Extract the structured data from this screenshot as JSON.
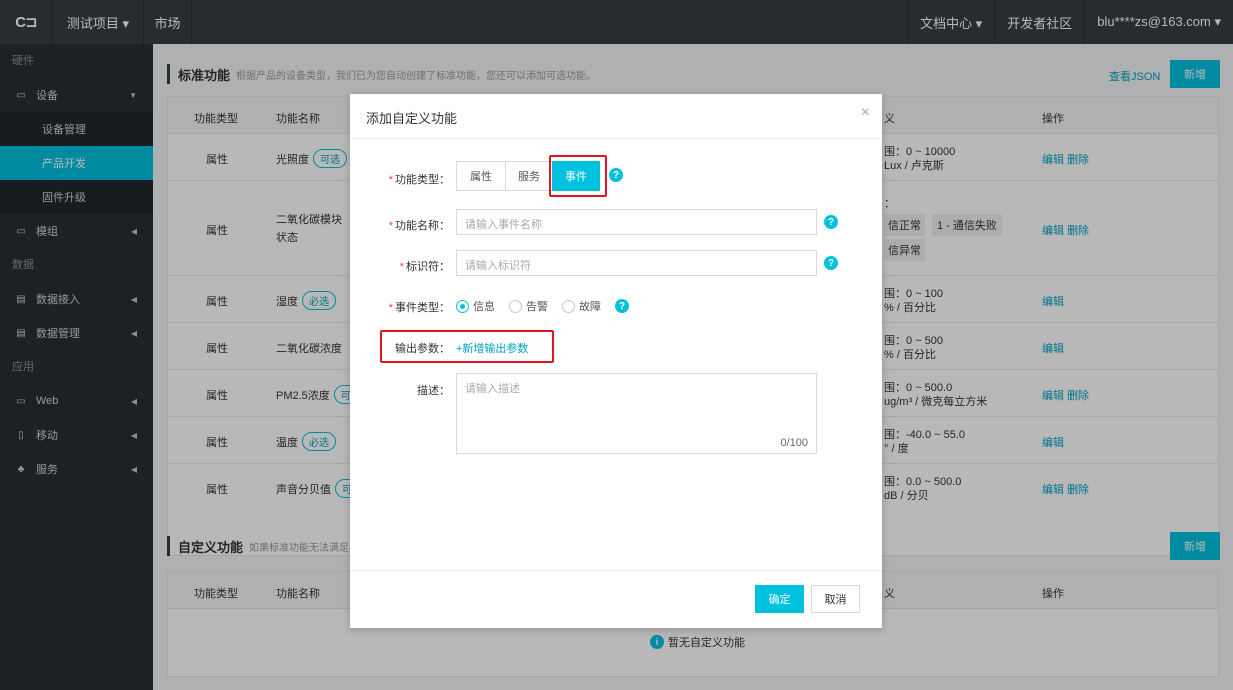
{
  "topbar": {
    "logo": "C⊐",
    "project": "测试项目 ▾",
    "market": "市场",
    "doc_center": "文档中心 ▾",
    "dev_community": "开发者社区",
    "user": "blu****zs@163.com ▾"
  },
  "sidebar": {
    "sec_hardware": "硬件",
    "device": "设备",
    "device_manage": "设备管理",
    "product_dev": "产品开发",
    "firmware": "固件升级",
    "module": "模组",
    "sec_data": "数据",
    "data_access": "数据接入",
    "data_manage": "数据管理",
    "sec_app": "应用",
    "web": "Web",
    "mobile": "移动",
    "service": "服务"
  },
  "standard": {
    "title": "标准功能",
    "desc": "根据产品的设备类型，我们已为您自动创建了标准功能，您还可以添加可选功能。",
    "view_json": "查看JSON",
    "add": "新增",
    "col_type": "功能类型",
    "col_name": "功能名称",
    "col_define": "义",
    "col_ops": "操作",
    "rows": [
      {
        "type": "属性",
        "name": "光照度",
        "tag": "可选",
        "def1": "围：0 ~ 10000",
        "def2": "Lux / 卢克斯",
        "edit": "编辑",
        "del": "删除"
      },
      {
        "type": "属性",
        "name": "二氧化碳模块状态",
        "tag": "",
        "def1": "：",
        "def2": "信正常",
        "def3": "1 - 通信失败",
        "def4": "信异常",
        "edit": "编辑",
        "del": "删除"
      },
      {
        "type": "属性",
        "name": "湿度",
        "tag": "必选",
        "def1": "围：0 ~ 100",
        "def2": "% / 百分比",
        "edit": "编辑",
        "del": ""
      },
      {
        "type": "属性",
        "name": "二氧化碳浓度",
        "tag": "",
        "def1": "围：0 ~ 500",
        "def2": "% / 百分比",
        "edit": "编辑",
        "del": ""
      },
      {
        "type": "属性",
        "name": "PM2.5浓度",
        "tag": "可",
        "def1": "围：0 ~ 500.0",
        "def2": "ug/m³ / 微克每立方米",
        "edit": "编辑",
        "del": "删除"
      },
      {
        "type": "属性",
        "name": "温度",
        "tag": "必选",
        "def1": "围：-40.0 ~ 55.0",
        "def2": "° / 度",
        "edit": "编辑",
        "del": ""
      },
      {
        "type": "属性",
        "name": "声音分贝值",
        "tag": "可",
        "def1": "围：0.0 ~ 500.0",
        "def2": "dB / 分贝",
        "edit": "编辑",
        "del": "删除"
      }
    ]
  },
  "custom": {
    "title": "自定义功能",
    "desc": "如果标准功能无法满足",
    "add": "新增",
    "col_type": "功能类型",
    "col_name": "功能名称",
    "col_define": "义",
    "col_ops": "操作",
    "empty": "暂无自定义功能"
  },
  "modal": {
    "title": "添加自定义功能",
    "close": "×",
    "func_type_label": "功能类型：",
    "seg_prop": "属性",
    "seg_service": "服务",
    "seg_event": "事件",
    "func_name_label": "功能名称：",
    "func_name_placeholder": "请输入事件名称",
    "identifier_label": "标识符：",
    "identifier_placeholder": "请输入标识符",
    "event_type_label": "事件类型：",
    "radio_info": "信息",
    "radio_alarm": "告警",
    "radio_fault": "故障",
    "output_label": "输出参数：",
    "output_add": "+新增输出参数",
    "desc_label": "描述：",
    "desc_placeholder": "请输入描述",
    "desc_count": "0/100",
    "ok": "确定",
    "cancel": "取消",
    "help": "?"
  },
  "colors": {
    "accent": "#00c1de",
    "highlight": "#e3141d",
    "topbar": "#373d41",
    "sidebar": "#2a2f32"
  }
}
